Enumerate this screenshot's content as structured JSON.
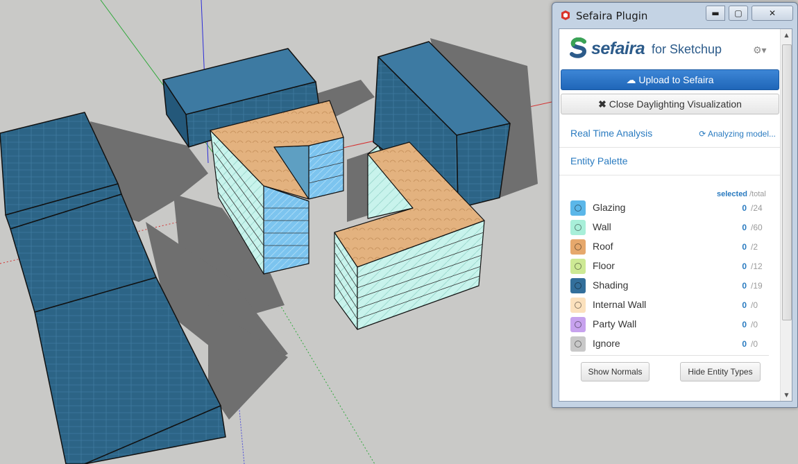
{
  "window": {
    "title": "Sefaira Plugin",
    "min_glyph": "▬",
    "max_glyph": "▢",
    "close_glyph": "✕"
  },
  "header": {
    "brand": "sefaira",
    "for_text": "for Sketchup",
    "settings_icon": "gear-icon",
    "gear_glyph": "⚙▾"
  },
  "actions": {
    "upload_label": "Upload to Sefaira",
    "close_viz_label": "Close Daylighting Visualization"
  },
  "sections": {
    "realtime_label": "Real Time Analysis",
    "realtime_status": "Analyzing model...",
    "entity_palette_label": "Entity Palette"
  },
  "palette": {
    "selected_header": "selected",
    "total_header": "/total",
    "entities": [
      {
        "label": "Glazing",
        "selected": "0",
        "total": "/24",
        "color": "#5bb7e9"
      },
      {
        "label": "Wall",
        "selected": "0",
        "total": "/60",
        "color": "#a8efd9"
      },
      {
        "label": "Roof",
        "selected": "0",
        "total": "/2",
        "color": "#e6a86c"
      },
      {
        "label": "Floor",
        "selected": "0",
        "total": "/12",
        "color": "#cde994"
      },
      {
        "label": "Shading",
        "selected": "0",
        "total": "/19",
        "color": "#336f9b"
      },
      {
        "label": "Internal Wall",
        "selected": "0",
        "total": "/0",
        "color": "#fbe1bd"
      },
      {
        "label": "Party Wall",
        "selected": "0",
        "total": "/0",
        "color": "#c7a2ee"
      },
      {
        "label": "Ignore",
        "selected": "0",
        "total": "/0",
        "color": "#c8c8c8"
      }
    ],
    "show_normals_label": "Show Normals",
    "hide_entity_types_label": "Hide Entity Types"
  },
  "colors": {
    "shading": "#2c6486",
    "roof": "#e3b27f",
    "wall": "#c8f3ec",
    "glazing": "#7cc4ef",
    "shadow": "#6e6e6e",
    "ground": "#c9c9c7",
    "accent": "#2a7bc0"
  }
}
